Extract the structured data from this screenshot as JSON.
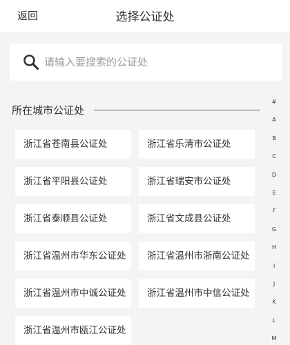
{
  "header": {
    "back_label": "返回",
    "title": "选择公证处"
  },
  "search": {
    "placeholder": "请输入要搜索的公证处",
    "value": ""
  },
  "section": {
    "label": "所在城市公证处"
  },
  "offices": [
    "浙江省苍南县公证处",
    "浙江省乐清市公证处",
    "浙江省平阳县公证处",
    "浙江省瑞安市公证处",
    "浙江省泰顺县公证处",
    "浙江省文成县公证处",
    "浙江省温州市华东公证处",
    "浙江省温州市浙南公证处",
    "浙江省温州市中诚公证处",
    "浙江省温州市中信公证处",
    "浙江省温州市瓯江公证处"
  ],
  "index_letters": [
    "#",
    "A",
    "B",
    "C",
    "D",
    "E",
    "F",
    "G",
    "H",
    "I",
    "J",
    "K",
    "L",
    "M"
  ]
}
